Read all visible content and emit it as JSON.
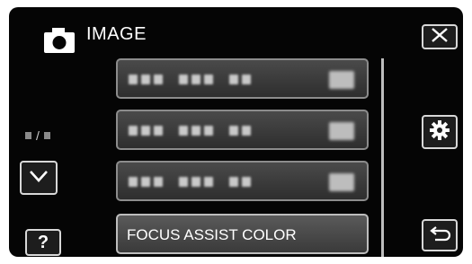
{
  "header": {
    "title": "IMAGE",
    "icon": "camera-icon"
  },
  "menu": {
    "items": [
      {
        "label": "",
        "blurred": true
      },
      {
        "label": "",
        "blurred": true
      },
      {
        "label": "",
        "blurred": true
      },
      {
        "label": "FOCUS ASSIST COLOR",
        "blurred": false,
        "selected": true
      }
    ]
  },
  "page_indicator": {
    "separator": "/"
  },
  "buttons": {
    "close": "close-icon",
    "settings": "gear-icon",
    "down": "chevron-down-icon",
    "help_label": "?",
    "back": "return-icon"
  },
  "colors": {
    "background": "#050505",
    "text": "#ffffff",
    "button_border": "#d8d8d8"
  }
}
